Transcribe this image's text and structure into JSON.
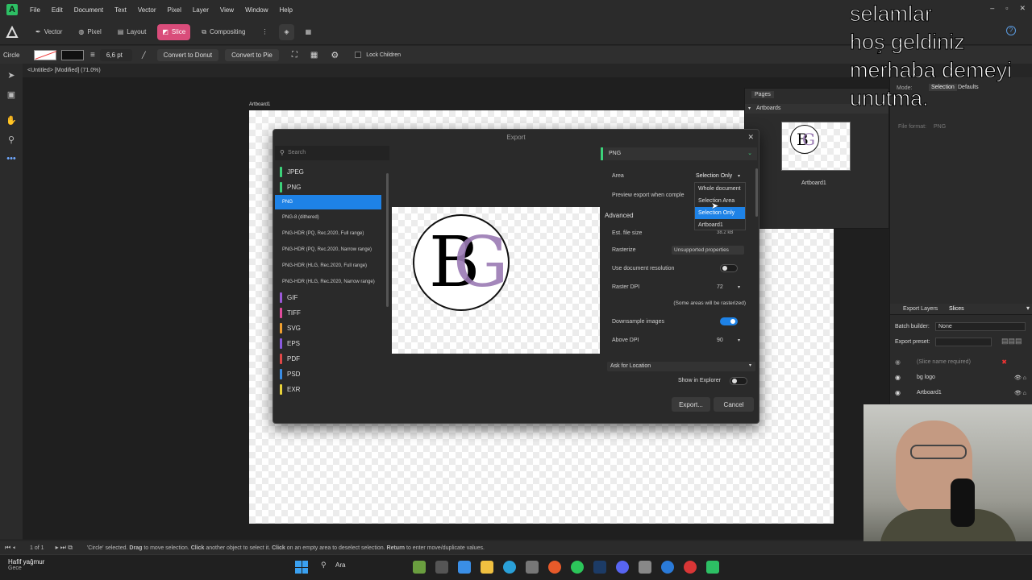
{
  "app": {
    "logo": "A",
    "doc_tab": "<Untitled> [Modified] (71.0%)",
    "artboard_label": "Artboard1"
  },
  "menu": [
    "File",
    "Edit",
    "Document",
    "Text",
    "Vector",
    "Pixel",
    "Layer",
    "View",
    "Window",
    "Help"
  ],
  "personas": {
    "vector": "Vector",
    "pixel": "Pixel",
    "layout": "Layout",
    "slice": "Slice",
    "compositing": "Compositing"
  },
  "context": {
    "shape": "Circle",
    "stroke_size": "6,6 pt",
    "convert_donut": "Convert to Donut",
    "convert_pie": "Convert to Pie",
    "lock_children": "Lock Children"
  },
  "pages_panel": {
    "tab_pages": "Pages",
    "tab_artboards": "Artboards",
    "thumb_label": "Artboard1"
  },
  "right_panel": {
    "mode_label": "Mode:",
    "mode_selection": "Selection",
    "mode_defaults": "Defaults",
    "file_format_label": "File format:",
    "file_format_value": "PNG",
    "tab_export_layers": "Export Layers",
    "tab_slices": "Slices",
    "batch_builder_label": "Batch builder:",
    "batch_builder_value": "None",
    "export_preset_label": "Export preset:",
    "slices": [
      {
        "name": "(Slice name required)"
      },
      {
        "name": "bg logo"
      },
      {
        "name": "Artboard1"
      }
    ]
  },
  "dialog": {
    "title": "Export",
    "search_placeholder": "Search",
    "formats": [
      {
        "label": "JPEG",
        "color": "#3cd27a"
      },
      {
        "label": "PNG",
        "color": "#3cd27a"
      }
    ],
    "png_selected": "PNG",
    "png_variants": [
      "PNG-8 (dithered)",
      "PNG-HDR (PQ, Rec.2020, Full range)",
      "PNG-HDR (PQ, Rec.2020, Narrow range)",
      "PNG-HDR (HLG, Rec.2020, Full range)",
      "PNG-HDR (HLG, Rec.2020, Narrow range)"
    ],
    "other_formats": [
      {
        "label": "GIF",
        "color": "#9b59d8"
      },
      {
        "label": "TIFF",
        "color": "#e04b9b"
      },
      {
        "label": "SVG",
        "color": "#f0a030"
      },
      {
        "label": "EPS",
        "color": "#8a5adf"
      },
      {
        "label": "PDF",
        "color": "#e04848"
      },
      {
        "label": "PSD",
        "color": "#3a8ee6"
      },
      {
        "label": "EXR",
        "color": "#e8d23a"
      }
    ],
    "settings_header": "PNG",
    "area_label": "Area",
    "area_value": "Selection Only",
    "preview_label": "Preview export when comple",
    "advanced_label": "Advanced",
    "est_size_label": "Est. file size",
    "est_size_value": "38.2 kB",
    "rasterize_label": "Rasterize",
    "rasterize_value": "Unsupported properties",
    "use_doc_res_label": "Use document resolution",
    "use_doc_res_on": false,
    "raster_dpi_label": "Raster DPI",
    "raster_dpi_value": "72",
    "rasterize_note": "(Some areas will be rasterized)",
    "downsample_label": "Downsample images",
    "downsample_on": true,
    "above_dpi_label": "Above DPI",
    "above_dpi_value": "90",
    "location_value": "Ask for Location",
    "show_in_explorer_label": "Show in Explorer",
    "show_in_explorer_on": false,
    "export_button": "Export...",
    "cancel_button": "Cancel",
    "area_options": [
      "Whole document",
      "Selection Area",
      "Selection Only",
      "Artboard1"
    ],
    "area_selected_index": 2
  },
  "logo_letters": {
    "b": "B",
    "g": "G"
  },
  "overlay_text": [
    "selamlar",
    "hoş geldiniz",
    "merhaba demeyi",
    "unutma."
  ],
  "status": {
    "pages": "1 of 1",
    "message_a": "'Circle' selected. ",
    "drag": "Drag",
    "message_b": " to move selection. ",
    "click": "Click",
    "message_c": " another object to select it. ",
    "click2": "Click",
    "message_d": " on an empty area to deselect selection. ",
    "return": "Return",
    "message_e": " to enter move/duplicate values."
  },
  "taskbar": {
    "weather_title": "Hafif yağmur",
    "weather_sub": "Gece",
    "search_label": "Ara"
  },
  "colors": {
    "accent_pink": "#d94c7a",
    "selection_blue": "#1e82e6",
    "png_green": "#3cd27a"
  }
}
